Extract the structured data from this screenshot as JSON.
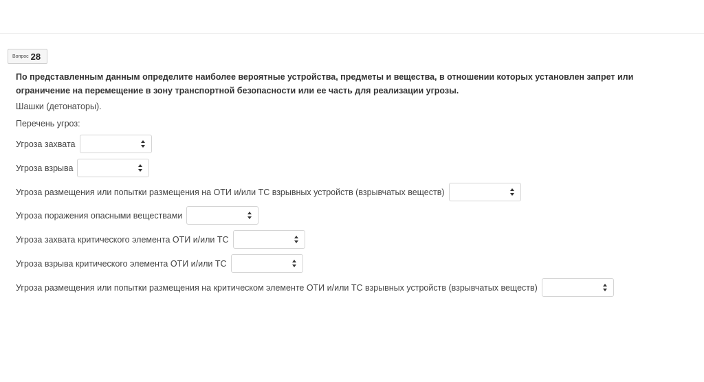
{
  "question": {
    "label": "Вопрос",
    "number": "28",
    "prompt": "По представленным данным определите наиболее вероятные устройства, предметы и вещества, в отношении которых установлен запрет или ограничение на перемещение в зону транспортной безопасности или ее часть для реализации угрозы.",
    "item": "Шашки (детонаторы).",
    "threats_heading": "Перечень угроз:"
  },
  "threats": [
    {
      "label": "Угроза захвата",
      "selected": ""
    },
    {
      "label": "Угроза взрыва",
      "selected": ""
    },
    {
      "label": "Угроза размещения или попытки размещения на ОТИ и/или ТС взрывных устройств (взрывчатых веществ)",
      "selected": ""
    },
    {
      "label": "Угроза поражения опасными веществами",
      "selected": ""
    },
    {
      "label": "Угроза захвата критического элемента ОТИ и/или ТС",
      "selected": ""
    },
    {
      "label": "Угроза взрыва критического элемента ОТИ и/или ТС",
      "selected": ""
    },
    {
      "label": "Угроза размещения или попытки размещения на критическом элементе ОТИ и/или ТС взрывных устройств (взрывчатых веществ)",
      "selected": ""
    }
  ],
  "icons": {
    "select_caret": "up-down-caret-icon"
  },
  "colors": {
    "panel_background": "#fcfcdd",
    "panel_border": "#e3e3c6"
  }
}
